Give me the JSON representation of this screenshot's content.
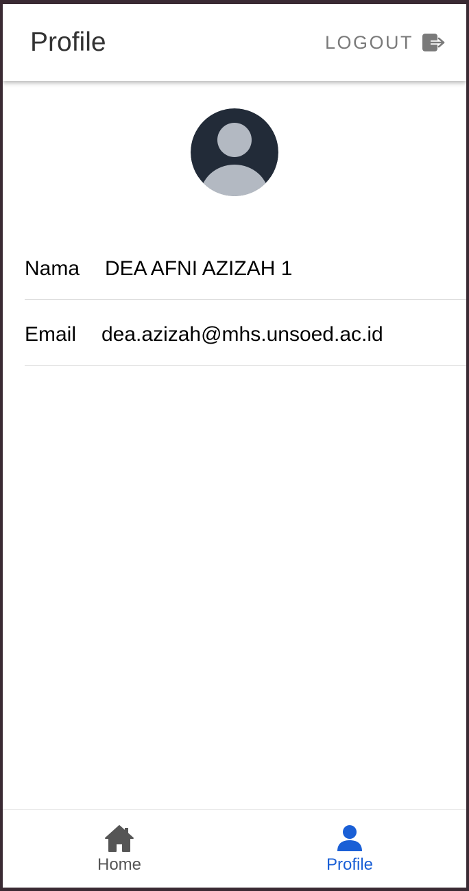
{
  "header": {
    "title": "Profile",
    "logout_label": "LOGOUT",
    "logout_icon": "logout-icon"
  },
  "avatar": {
    "icon": "person-avatar-icon",
    "background_color": "#222b38",
    "figure_color": "#b3b9c2"
  },
  "profile": {
    "name_label": "Nama",
    "name_value": "DEA AFNI AZIZAH 1",
    "email_label": "Email",
    "email_value": "dea.azizah@mhs.unsoed.ac.id"
  },
  "tab_bar": {
    "tabs": [
      {
        "label": "Home",
        "icon": "home-icon",
        "active": false
      },
      {
        "label": "Profile",
        "icon": "person-icon",
        "active": true
      }
    ],
    "active_color": "#1a5fd6",
    "inactive_color": "#555555"
  }
}
